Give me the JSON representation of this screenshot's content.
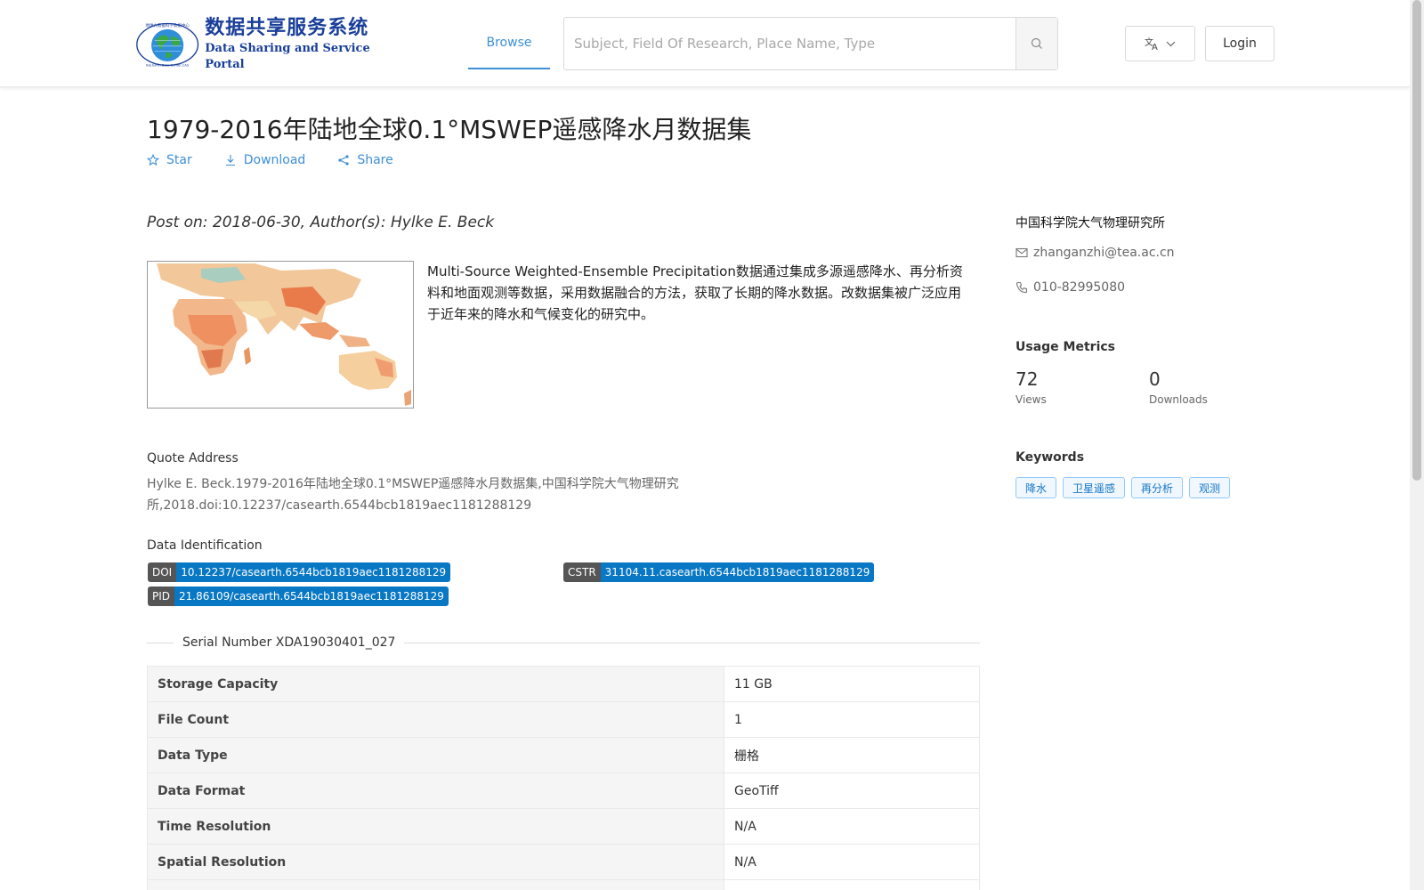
{
  "header": {
    "logo": {
      "cn": "数据共享服务系统",
      "en": "Data Sharing and Service Portal",
      "seal_text": "地球大数据科学数据中心",
      "seal_sub": "Big Earth Data Center,CAS"
    },
    "nav_browse": "Browse",
    "search_placeholder": "Subject, Field Of Research, Place Name, Type",
    "login": "Login",
    "icons": {
      "search": "search-icon",
      "language": "translate-icon",
      "dropdown": "chevron-down-icon"
    }
  },
  "dataset": {
    "title": "1979-2016年陆地全球0.1°MSWEP遥感降水月数据集",
    "actions": {
      "star": "Star",
      "download": "Download",
      "share": "Share"
    },
    "post_line": "Post on: 2018-06-30, Author(s): Hylke E. Beck",
    "description": "Multi-Source Weighted-Ensemble Precipitation数据通过集成多源遥感降水、再分析资料和地面观测等数据，采用数据融合的方法，获取了长期的降水数据。改数据集被广泛应用于近年来的降水和气候变化的研究中。",
    "quote_heading": "Quote Address",
    "quote_text": "Hylke E. Beck.1979-2016年陆地全球0.1°MSWEP遥感降水月数据集,中国科学院大气物理研究所,2018.doi:10.12237/casearth.6544bcb1819aec1181288129",
    "identification_heading": "Data Identification",
    "identifiers": {
      "doi": {
        "key": "DOI",
        "value": "10.12237/casearth.6544bcb1819aec1181288129"
      },
      "cstr": {
        "key": "CSTR",
        "value": "31104.11.casearth.6544bcb1819aec1181288129"
      },
      "pid": {
        "key": "PID",
        "value": "21.86109/casearth.6544bcb1819aec1181288129"
      }
    },
    "serial": "Serial Number XDA19030401_027",
    "properties": [
      {
        "key": "Storage Capacity",
        "value": "11 GB"
      },
      {
        "key": "File Count",
        "value": "1"
      },
      {
        "key": "Data Type",
        "value": "栅格"
      },
      {
        "key": "Data Format",
        "value": "GeoTiff"
      },
      {
        "key": "Time Resolution",
        "value": "N/A"
      },
      {
        "key": "Spatial Resolution",
        "value": "N/A"
      }
    ]
  },
  "sidebar": {
    "organization": "中国科学院大气物理研究所",
    "email": "zhanganzhi@tea.ac.cn",
    "phone": "010-82995080",
    "usage_heading": "Usage Metrics",
    "views": {
      "count": "72",
      "label": "Views"
    },
    "downloads": {
      "count": "0",
      "label": "Downloads"
    },
    "keywords_heading": "Keywords",
    "keywords": [
      "降水",
      "卫星遥感",
      "再分析",
      "观测"
    ]
  },
  "colors": {
    "accent": "#3d8fd6",
    "logo_blue": "#1a3f9a",
    "id_value_bg": "#0877c4",
    "id_key_bg": "#555555"
  }
}
